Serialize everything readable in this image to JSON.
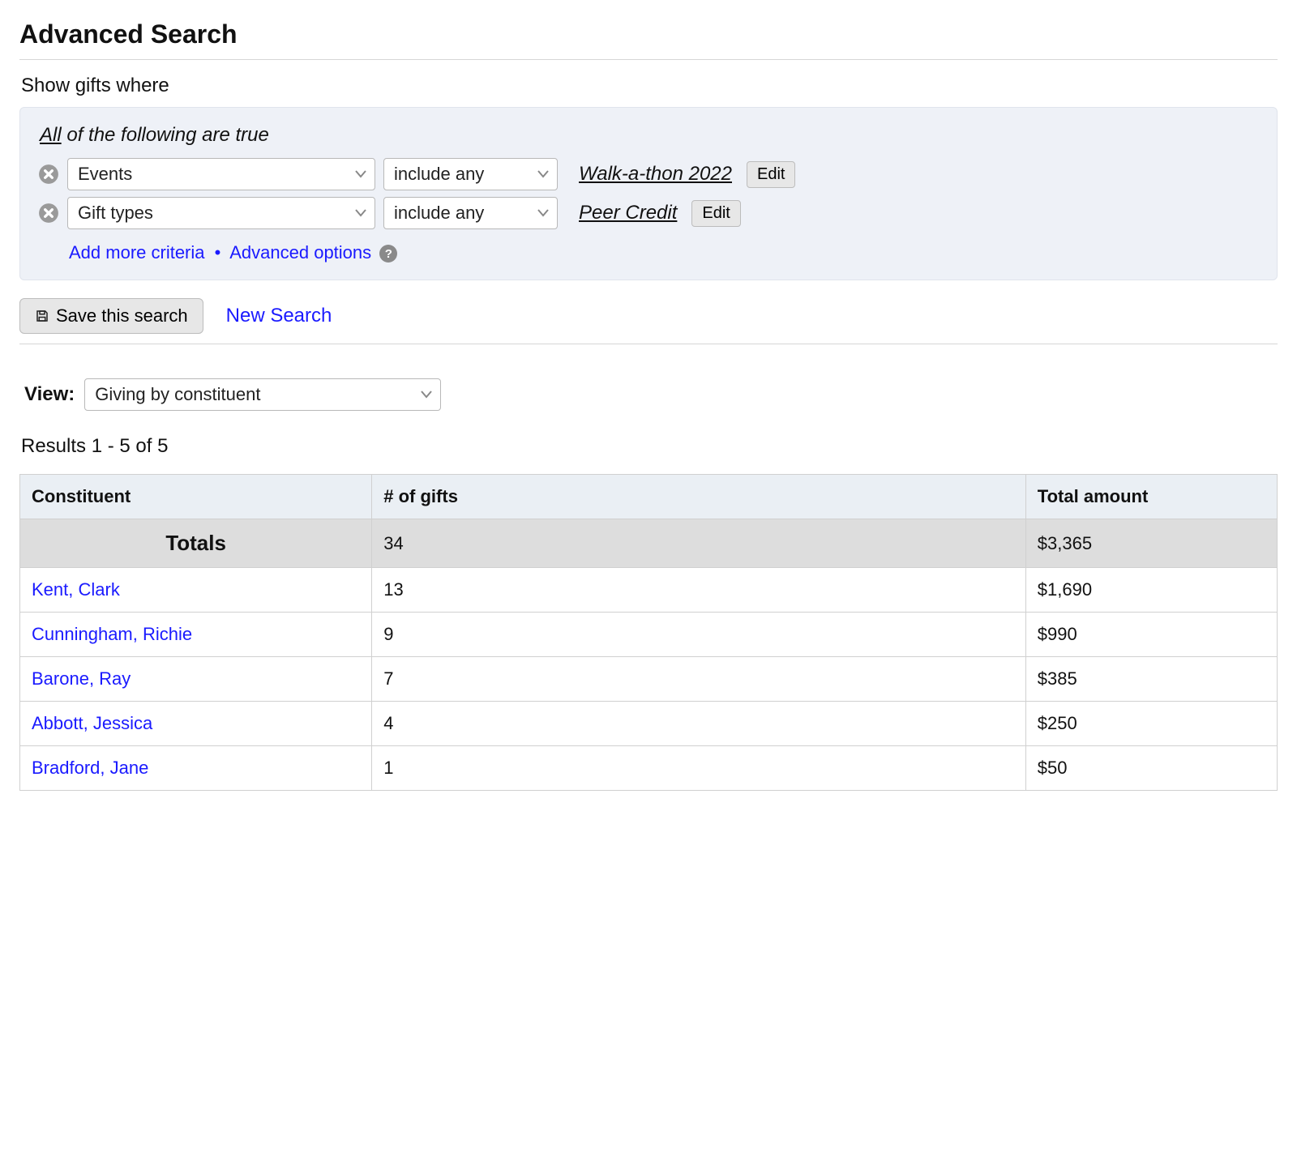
{
  "header": {
    "title": "Advanced Search"
  },
  "intro": "Show gifts where",
  "criteria": {
    "head_prefix": "All",
    "head_rest": " of the following are true",
    "rows": [
      {
        "field": "Events",
        "op": "include any",
        "value": "Walk-a-thon 2022",
        "edit_label": "Edit"
      },
      {
        "field": "Gift types",
        "op": "include any",
        "value": "Peer Credit",
        "edit_label": "Edit"
      }
    ],
    "add_more": "Add more criteria",
    "advanced": "Advanced options"
  },
  "actions": {
    "save_label": "Save this search",
    "new_search": "New Search"
  },
  "view": {
    "label": "View:",
    "value": "Giving by constituent"
  },
  "results_text": "Results 1 - 5 of 5",
  "table": {
    "headers": {
      "constituent": "Constituent",
      "gifts": "# of gifts",
      "total": "Total amount"
    },
    "totals": {
      "label": "Totals",
      "gifts": "34",
      "total": "$3,365"
    },
    "rows": [
      {
        "name": "Kent, Clark",
        "gifts": "13",
        "total": "$1,690"
      },
      {
        "name": "Cunningham, Richie",
        "gifts": "9",
        "total": "$990"
      },
      {
        "name": "Barone, Ray",
        "gifts": "7",
        "total": "$385"
      },
      {
        "name": "Abbott, Jessica",
        "gifts": "4",
        "total": "$250"
      },
      {
        "name": "Bradford, Jane",
        "gifts": "1",
        "total": "$50"
      }
    ]
  }
}
